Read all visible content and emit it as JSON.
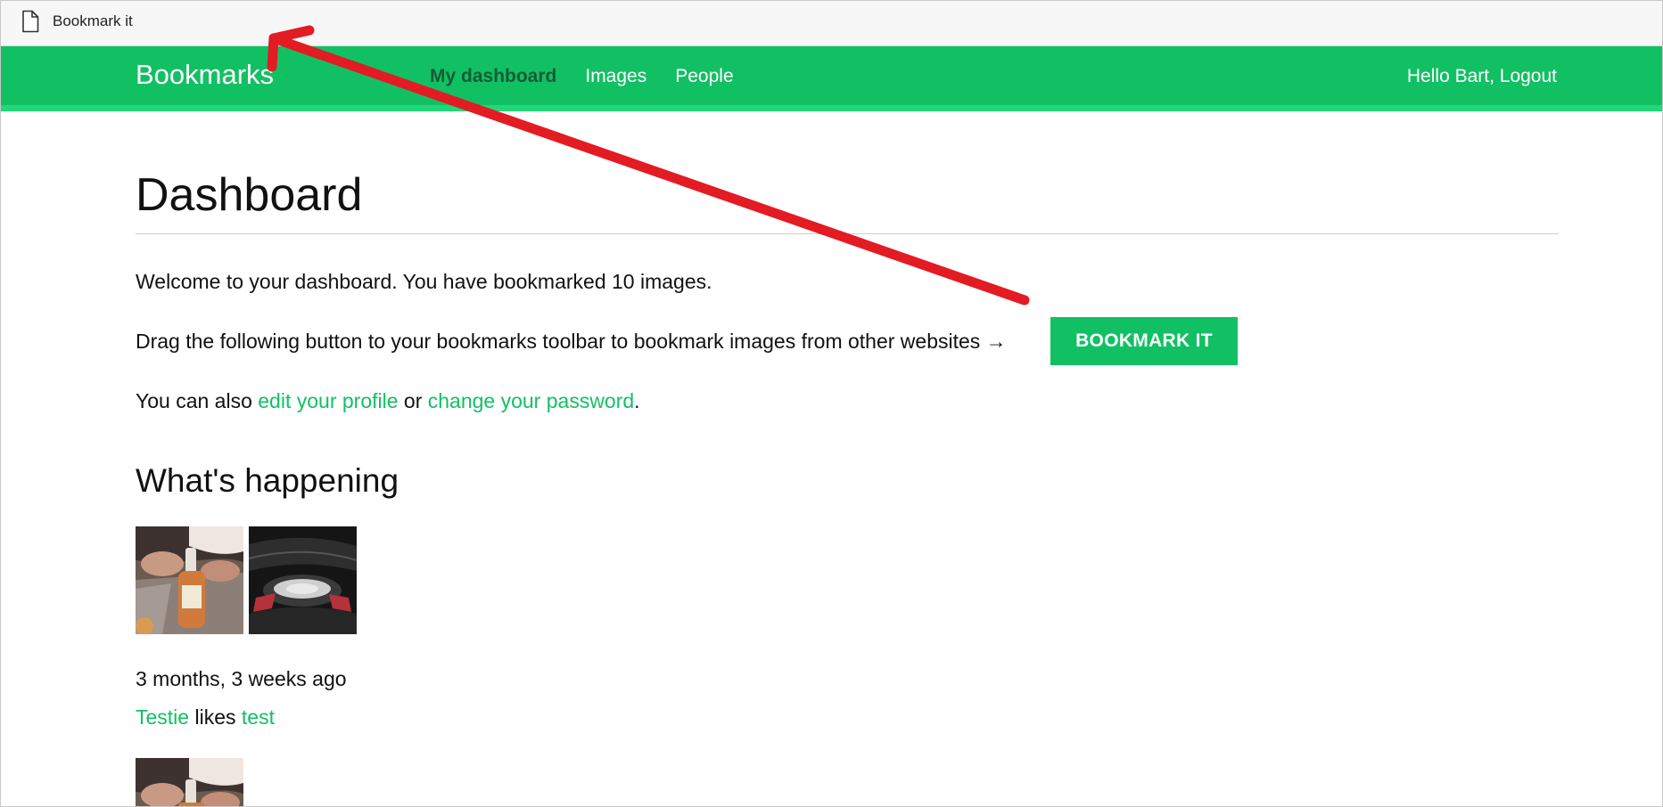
{
  "bookmarks_bar": {
    "item_label": "Bookmark it",
    "item_icon": "page-icon"
  },
  "header": {
    "brand": "Bookmarks",
    "nav": [
      {
        "label": "My dashboard",
        "active": true
      },
      {
        "label": "Images",
        "active": false
      },
      {
        "label": "People",
        "active": false
      }
    ],
    "greeting": "Hello Bart, ",
    "logout_label": "Logout"
  },
  "main": {
    "title": "Dashboard",
    "welcome_text": "Welcome to your dashboard. You have bookmarked 10 images.",
    "drag_text": "Drag the following button to your bookmarks toolbar to bookmark images from other websites →",
    "bookmark_button_label": "BOOKMARK IT",
    "also_prefix": "You can also ",
    "edit_profile_link": "edit your profile",
    "also_middle": " or ",
    "change_password_link": "change your password",
    "also_suffix": ".",
    "section_title": "What's happening",
    "activity": {
      "time_ago": "3 months, 3 weeks ago",
      "user_link": "Testie",
      "verb": " likes ",
      "target_link": "test"
    }
  },
  "colors": {
    "brand_green": "#12c064",
    "header_stripe": "#20d87a",
    "active_nav": "#145c34",
    "annotation_red": "#e31b23"
  }
}
